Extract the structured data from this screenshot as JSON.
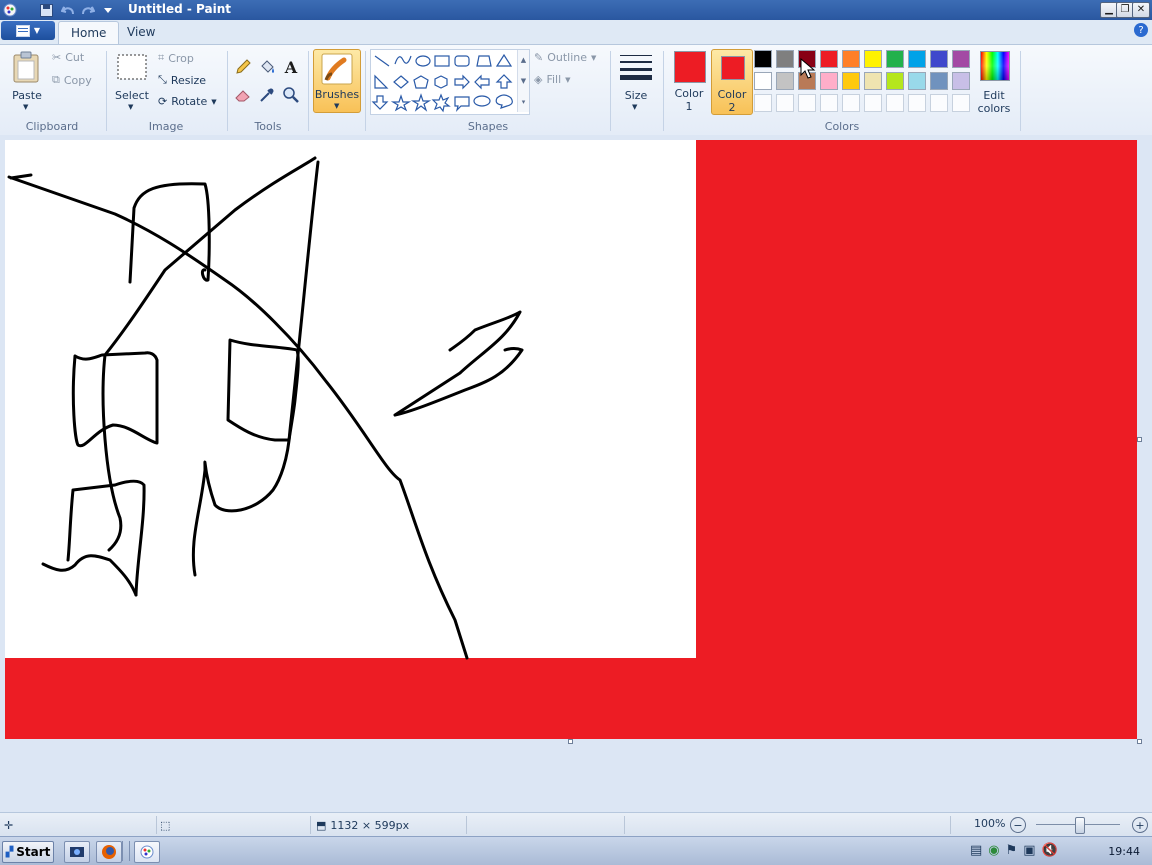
{
  "window": {
    "title": "Untitled - Paint",
    "controls": [
      "minimize-icon",
      "restore-icon",
      "close-icon"
    ]
  },
  "quick_access": [
    "save-icon",
    "undo-icon",
    "redo-icon",
    "customize-icon"
  ],
  "tabs": [
    {
      "label": "Home",
      "active": true
    },
    {
      "label": "View",
      "active": false
    }
  ],
  "ribbon": {
    "clipboard": {
      "label": "Clipboard",
      "paste": "Paste",
      "cut": "Cut",
      "copy": "Copy"
    },
    "image": {
      "label": "Image",
      "select": "Select",
      "crop": "Crop",
      "resize": "Resize",
      "rotate": "Rotate"
    },
    "tools": {
      "label": "Tools"
    },
    "brushes": {
      "label": "Brushes"
    },
    "shapes": {
      "label": "Shapes",
      "outline": "Outline",
      "fill": "Fill"
    },
    "size": {
      "label": "Size"
    },
    "colors": {
      "label": "Colors",
      "color1": "Color 1",
      "color1_value": "#ed1c24",
      "color2": "Color 2",
      "color2_value": "#ed1c24",
      "edit": "Edit colors",
      "palette_row1": [
        "#000000",
        "#7f7f7f",
        "#880015",
        "#ed1c24",
        "#ff7f27",
        "#fff200",
        "#22b14c",
        "#00a2e8",
        "#3f48cc",
        "#a349a4"
      ],
      "palette_row2": [
        "#ffffff",
        "#c3c3c3",
        "#b97a57",
        "#ffaec9",
        "#ffc90e",
        "#efe4b0",
        "#b5e61d",
        "#99d9ea",
        "#7092be",
        "#c8bfe7"
      ]
    }
  },
  "canvas": {
    "background": "#ed1c24",
    "white_region": "#ffffff",
    "stroke": "#000000"
  },
  "status": {
    "canvas_size": "1132 × 599px",
    "zoom": "100%"
  },
  "taskbar": {
    "start": "Start",
    "clock": "19:44"
  }
}
